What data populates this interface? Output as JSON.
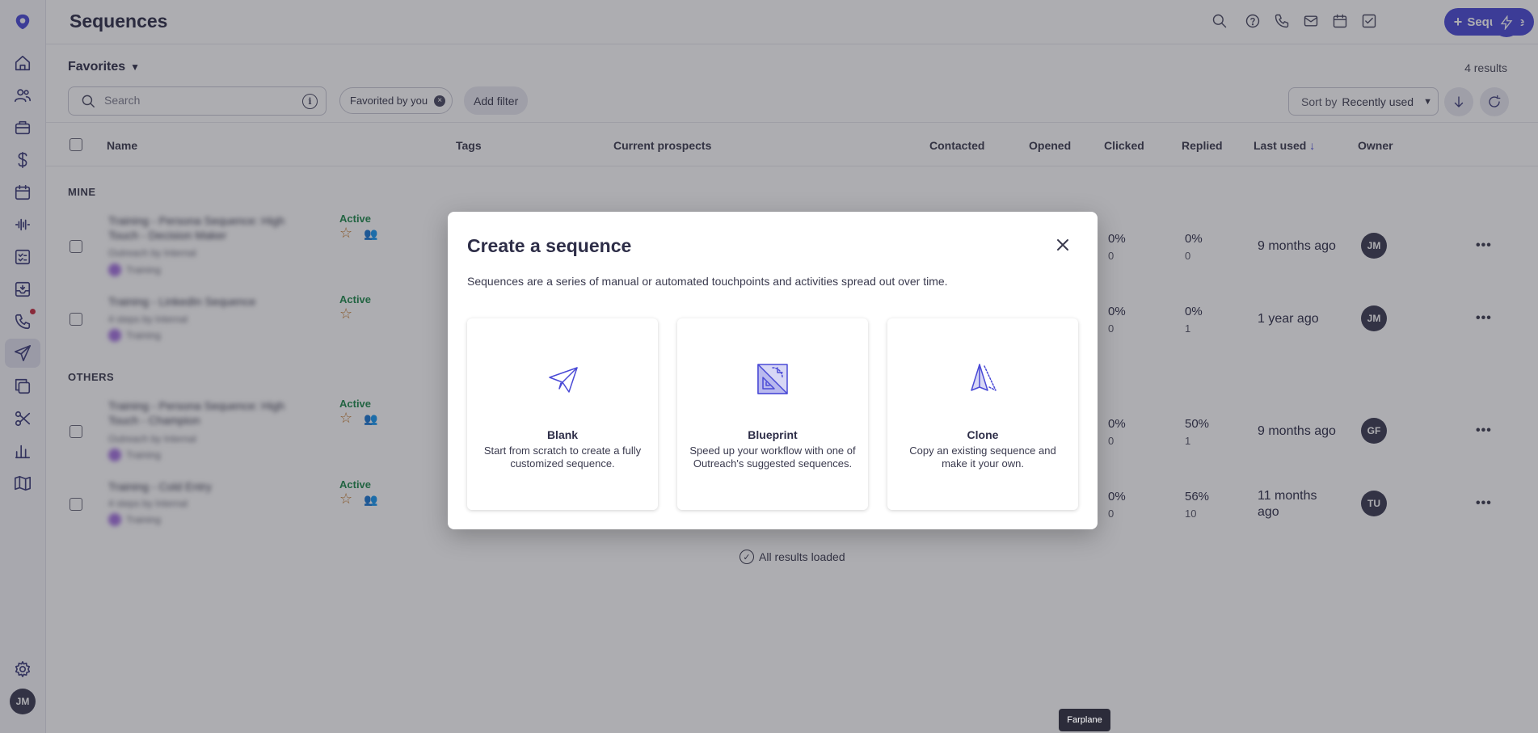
{
  "header": {
    "title": "Sequences",
    "sequence_button": "Sequence"
  },
  "filters": {
    "view": "Favorites",
    "results": "4 results",
    "search_placeholder": "Search",
    "chip": "Favorited by you",
    "add_filter": "Add filter",
    "sort_label": "Sort by",
    "sort_value": "Recently used"
  },
  "table": {
    "columns": [
      "Name",
      "Tags",
      "Current prospects",
      "Contacted",
      "Opened",
      "Clicked",
      "Replied",
      "Last used",
      "Owner"
    ],
    "groups": [
      "MINE",
      "OTHERS"
    ],
    "rows": [
      {
        "name": "Training - Persona Sequence: High Touch - Decision Maker",
        "sub": "Outreach by Internal",
        "tag": "Training",
        "status": "Active",
        "clicked": "0%",
        "clicked_n": "0",
        "replied": "0%",
        "replied_n": "0",
        "last_used": "9 months ago",
        "owner": "JM"
      },
      {
        "name": "Training - LinkedIn Sequence",
        "sub": "4 steps by Internal",
        "tag": "Training",
        "status": "Active",
        "clicked": "0%",
        "clicked_n": "0",
        "replied": "0%",
        "replied_n": "1",
        "last_used": "1 year ago",
        "owner": "JM"
      },
      {
        "name": "Training - Persona Sequence: High Touch - Champion",
        "sub": "Outreach by Internal",
        "tag": "Training",
        "status": "Active",
        "clicked": "0%",
        "clicked_n": "0",
        "replied": "50%",
        "replied_n": "1",
        "last_used": "9 months ago",
        "owner": "GF"
      },
      {
        "name": "Training - Cold Entry",
        "sub": "4 steps by Internal",
        "tag": "Training",
        "status": "Active",
        "clicked": "0%",
        "clicked_n": "0",
        "replied": "56%",
        "replied_n": "10",
        "last_used": "11 months ago",
        "owner": "TU"
      }
    ],
    "all_loaded": "All results loaded"
  },
  "modal": {
    "title": "Create a sequence",
    "description": "Sequences are a series of manual or automated touchpoints and activities spread out over time.",
    "cards": [
      {
        "title": "Blank",
        "desc": "Start from scratch to create a fully customized sequence.",
        "icon": "paper-plane-icon"
      },
      {
        "title": "Blueprint",
        "desc": "Speed up your workflow with one of Outreach's suggested sequences.",
        "icon": "blueprint-icon"
      },
      {
        "title": "Clone",
        "desc": "Copy an existing sequence and make it your own.",
        "icon": "clone-icon"
      }
    ]
  },
  "user": {
    "initials": "JM"
  },
  "tooltip": "Farplane",
  "colors": {
    "accent": "#4a4ad6",
    "active_status": "#1f8a4c"
  }
}
